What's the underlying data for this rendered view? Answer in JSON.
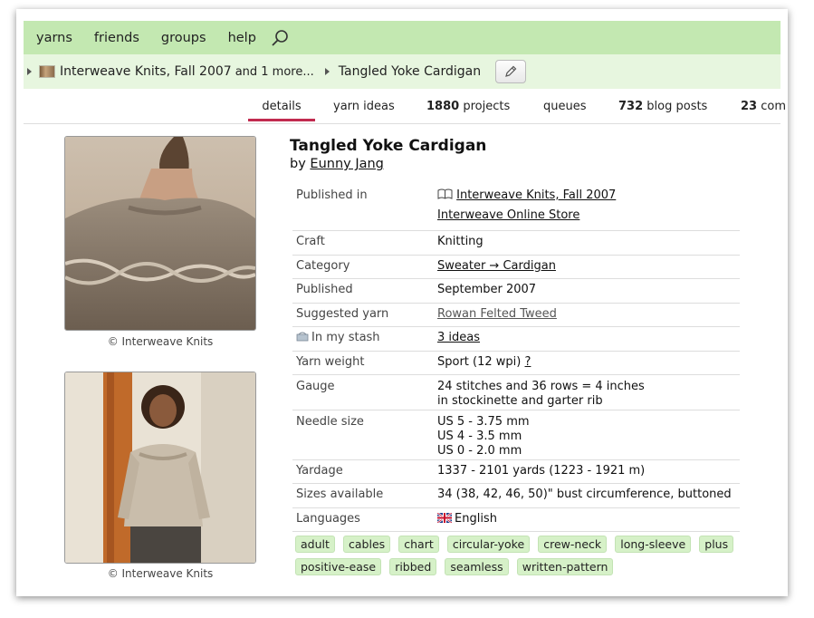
{
  "nav": {
    "items": [
      "yarns",
      "friends",
      "groups",
      "help"
    ],
    "search_icon": "search-icon"
  },
  "breadcrumb": {
    "source": "Interweave Knits, Fall 2007",
    "more": "and 1 more...",
    "current": "Tangled Yoke Cardigan",
    "edit_icon": "pencil-icon"
  },
  "tabs": [
    {
      "count": "",
      "label": "details"
    },
    {
      "count": "",
      "label": "yarn ideas"
    },
    {
      "count": "1880",
      "label": "projects"
    },
    {
      "count": "",
      "label": "queues"
    },
    {
      "count": "732",
      "label": "blog posts"
    },
    {
      "count": "23",
      "label": "com"
    }
  ],
  "photos": [
    {
      "caption": "© Interweave Knits"
    },
    {
      "caption": "© Interweave Knits"
    }
  ],
  "pattern": {
    "title": "Tangled Yoke Cardigan",
    "by": "by",
    "author": "Eunny Jang"
  },
  "details": {
    "published_in": {
      "label": "Published in",
      "value": "Interweave Knits, Fall 2007",
      "value2": "Interweave Online Store"
    },
    "craft": {
      "label": "Craft",
      "value": "Knitting"
    },
    "category": {
      "label": "Category",
      "value": "Sweater → Cardigan"
    },
    "published": {
      "label": "Published",
      "value": "September 2007"
    },
    "suggested_yarn": {
      "label": "Suggested yarn",
      "value": "Rowan Felted Tweed"
    },
    "in_my_stash": {
      "label": "In my stash",
      "value": "3 ideas"
    },
    "yarn_weight": {
      "label": "Yarn weight",
      "value": "Sport (12 wpi)",
      "help": "?"
    },
    "gauge": {
      "label": "Gauge",
      "line1": "24 stitches and 36 rows = 4 inches",
      "line2": "in stockinette and garter rib"
    },
    "needle_size": {
      "label": "Needle size",
      "line1": "US 5 - 3.75 mm",
      "line2": "US 4 - 3.5 mm",
      "line3": "US 0 - 2.0 mm"
    },
    "yardage": {
      "label": "Yardage",
      "value": "1337 - 2101 yards (1223 - 1921 m)"
    },
    "sizes": {
      "label": "Sizes available",
      "value": "34 (38, 42, 46, 50)\" bust circumference, buttoned"
    },
    "languages": {
      "label": "Languages",
      "value": "English"
    }
  },
  "tags": [
    "adult",
    "cables",
    "chart",
    "circular-yoke",
    "crew-neck",
    "long-sleeve",
    "plus",
    "positive-ease",
    "ribbed",
    "seamless",
    "written-pattern"
  ],
  "colors": {
    "nav_bg": "#c3e8b1",
    "crumb_bg": "#e7f6df",
    "tab_active": "#c12a4f",
    "tag_bg": "#d6f1c8"
  }
}
